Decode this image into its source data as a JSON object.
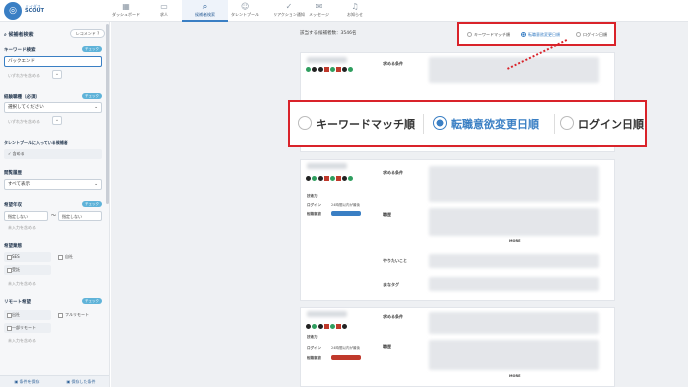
{
  "app": {
    "logo_letter": "◎",
    "brand_small": "ミイダス",
    "brand": "SCOUT"
  },
  "nav": [
    {
      "label": "ダッシュボード",
      "icon": "dashboard-icon",
      "glyph": "▦"
    },
    {
      "label": "求人",
      "icon": "jobs-icon",
      "glyph": "▭"
    },
    {
      "label": "候補者検索",
      "icon": "search-icon",
      "glyph": "⌕"
    },
    {
      "label": "タレントプール",
      "icon": "people-icon",
      "glyph": "☺"
    },
    {
      "label": "リアクション通知",
      "icon": "check-icon",
      "glyph": "✓"
    },
    {
      "label": "メッセージ",
      "icon": "message-icon",
      "glyph": "✉"
    },
    {
      "label": "お知らせ",
      "icon": "bell-icon",
      "glyph": "♫"
    }
  ],
  "sidebar": {
    "title": "候補者検索",
    "reset": "レコメンド ?",
    "keyword_label": "キーワード検索",
    "keyword_badge": "チェック",
    "keyword_value": "バックエンド",
    "keyword_hint": "いずれかを含める",
    "job_label": "経験職種（必須）",
    "job_badge": "チェック",
    "job_select": "選択してください",
    "job_hint": "いずれかを含める",
    "pool_label": "タレントプールに入っている候補者",
    "pool_value": "✓ 含める",
    "display_label": "閲覧履歴",
    "display_value": "すべて表示",
    "age_label": "希望年収",
    "age_badge": "チェック",
    "age_from": "指定しない",
    "age_to": "指定しない",
    "age_sep": "〜",
    "age_hint": "未入力を含める",
    "biz_label": "希望業態",
    "biz_opt1": "SES",
    "biz_opt2": "自社",
    "biz_opt3": "受託",
    "biz_hint": "未入力を含める",
    "remote_label": "リモート希望",
    "remote_badge": "チェック",
    "remote_opt1": "出社",
    "remote_opt2": "フルリモート",
    "remote_opt3": "一部リモート",
    "remote_hint": "未入力を含める",
    "save_button": "条件を保存",
    "saved_button": "保存した条件"
  },
  "main": {
    "count": "該当する候補者数：3546名",
    "sort": [
      "キーワードマッチ順",
      "転職意欲変更日順",
      "ログイン日順"
    ],
    "sort_selected": 1
  },
  "cards": {
    "labels": {
      "desired": "求める条件",
      "skill": "職歴",
      "can_do": "やりたいこと",
      "tags": "まなタグ",
      "more": "MORE",
      "ability": "技術力",
      "login": "ログイン",
      "intent": "転職意欲",
      "login_val": "24時間以内が最後"
    },
    "tag_label_1": "まなタグ ⓘ"
  }
}
